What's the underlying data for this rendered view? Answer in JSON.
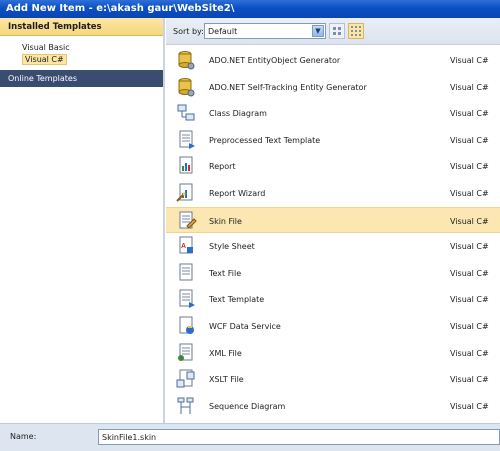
{
  "window": {
    "title": "Add New Item - e:\\akash gaur\\WebSite2\\"
  },
  "sidebar": {
    "installed_header": "Installed Templates",
    "items": [
      {
        "label": "Visual Basic",
        "selected": false
      },
      {
        "label": "Visual C#",
        "selected": true
      }
    ],
    "online_header": "Online Templates"
  },
  "toolbar": {
    "sort_label": "Sort by:",
    "sort_value": "Default"
  },
  "templates": [
    {
      "name": "ADO.NET EntityObject Generator",
      "language": "Visual C#",
      "icon": "database-icon"
    },
    {
      "name": "ADO.NET Self-Tracking Entity Generator",
      "language": "Visual C#",
      "icon": "database-icon"
    },
    {
      "name": "Class Diagram",
      "language": "Visual C#",
      "icon": "class-diagram-icon"
    },
    {
      "name": "Preprocessed Text Template",
      "language": "Visual C#",
      "icon": "text-template-icon"
    },
    {
      "name": "Report",
      "language": "Visual C#",
      "icon": "report-icon"
    },
    {
      "name": "Report Wizard",
      "language": "Visual C#",
      "icon": "report-wizard-icon"
    },
    {
      "name": "Skin File",
      "language": "Visual C#",
      "icon": "skin-file-icon",
      "selected": true
    },
    {
      "name": "Style Sheet",
      "language": "Visual C#",
      "icon": "style-sheet-icon"
    },
    {
      "name": "Text File",
      "language": "Visual C#",
      "icon": "text-file-icon"
    },
    {
      "name": "Text Template",
      "language": "Visual C#",
      "icon": "text-template-icon"
    },
    {
      "name": "WCF Data Service",
      "language": "Visual C#",
      "icon": "wcf-data-service-icon"
    },
    {
      "name": "XML File",
      "language": "Visual C#",
      "icon": "xml-file-icon"
    },
    {
      "name": "XSLT File",
      "language": "Visual C#",
      "icon": "xslt-file-icon"
    },
    {
      "name": "Sequence Diagram",
      "language": "Visual C#",
      "icon": "sequence-diagram-icon"
    }
  ],
  "footer": {
    "name_label": "Name:",
    "name_value": "SkinFile1.skin"
  },
  "colors": {
    "title_bar": "#0b4fc4",
    "selection": "#fce7b3",
    "online_header": "#384d6f"
  }
}
